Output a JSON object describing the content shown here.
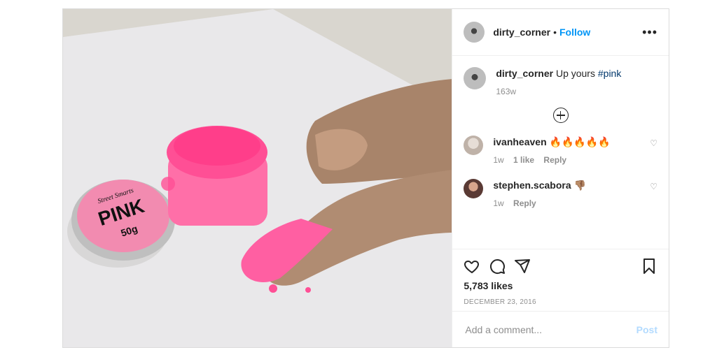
{
  "post": {
    "username": "dirty_corner",
    "separator": "•",
    "follow_label": "Follow",
    "more_label": "•••",
    "caption": {
      "username": "dirty_corner",
      "text": "Up yours",
      "hashtag": "#pink",
      "age": "163w"
    },
    "comments": [
      {
        "username": "ivanheaven",
        "text": "🔥🔥🔥🔥🔥",
        "age": "1w",
        "likes": "1 like",
        "reply": "Reply"
      },
      {
        "username": "stephen.scabora",
        "text": "👎🏽",
        "age": "1w",
        "reply": "Reply"
      }
    ],
    "likes": "5,783 likes",
    "date": "DECEMBER 23, 2016",
    "add_comment_placeholder": "Add a comment...",
    "post_button": "Post"
  },
  "photo": {
    "lid_brand": "Street Smarts",
    "lid_title": "PINK",
    "lid_weight": "50g"
  },
  "colors": {
    "accent": "#0095f6",
    "pink": "#ff5fa2"
  }
}
